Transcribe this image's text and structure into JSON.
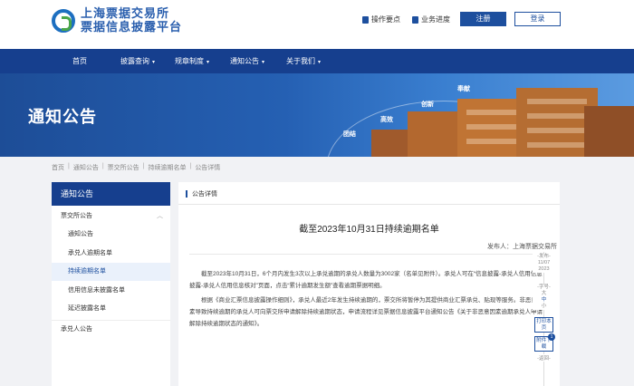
{
  "header": {
    "logo_line1": "上海票据交易所",
    "logo_line2": "票据信息披露平台",
    "links": [
      "操作要点",
      "业务进度"
    ],
    "register_label": "注册",
    "login_label": "登录"
  },
  "nav": {
    "items": [
      "首页",
      "披露查询",
      "规章制度",
      "通知公告",
      "关于我们"
    ]
  },
  "banner": {
    "title": "通知公告",
    "words": [
      "团结",
      "高效",
      "创新",
      "奉献"
    ]
  },
  "breadcrumb": [
    "首页",
    "通知公告",
    "票交所公告",
    "持续逾期名单",
    "公告详情"
  ],
  "sidebar": {
    "title": "通知公告",
    "items": [
      {
        "label": "票交所公告",
        "expanded": true
      },
      {
        "label": "通知公告"
      },
      {
        "label": "承兑人逾期名单"
      },
      {
        "label": "持续逾期名单",
        "active": true
      },
      {
        "label": "信用信息未披露名单"
      },
      {
        "label": "延迟披露名单"
      },
      {
        "label": "承兑人公告"
      }
    ]
  },
  "main": {
    "section_title": "公告详情",
    "doc_title": "截至2023年10月31日持续逾期名单",
    "publisher": "发布人：上海票据交易所",
    "para1_a": "截至2023年10月31日，6个月内发生3次以上承兑逾期的承兑人数量为3002家（名单见附件）。承兑人可在“信息披露-承兑人信用信息披露-承兑人信用信息核对”页面，点击“累计逾期发生额”查看逾期票据明细。",
    "para2_a": "根据《商业汇票信息披露操作细则》，承兑人最近2年发生持续逾期的，票交所将暂停为其提供商业汇票承兑、贴现等服务。非恶意因素导致持续逾期的承兑人可向票交所申请解除持续逾期状态，申请流程详见票据信息披露平台通知公告《关于非恶意因素逾期承兑人申请解除持续逾期状态的通知》。"
  },
  "rail": {
    "date_label": "发布",
    "date": "11/07",
    "year": "2023",
    "size_label": "字号",
    "size_big": "大",
    "size_mid": "中",
    "size_small": "小",
    "print_label": "打印本页",
    "attach_label": "附件下载",
    "attach_count": "1",
    "back_label": "返回"
  },
  "colors": {
    "brand": "#163f8e",
    "accent": "#1d4f9e",
    "active_bg": "#eaf1fb"
  }
}
